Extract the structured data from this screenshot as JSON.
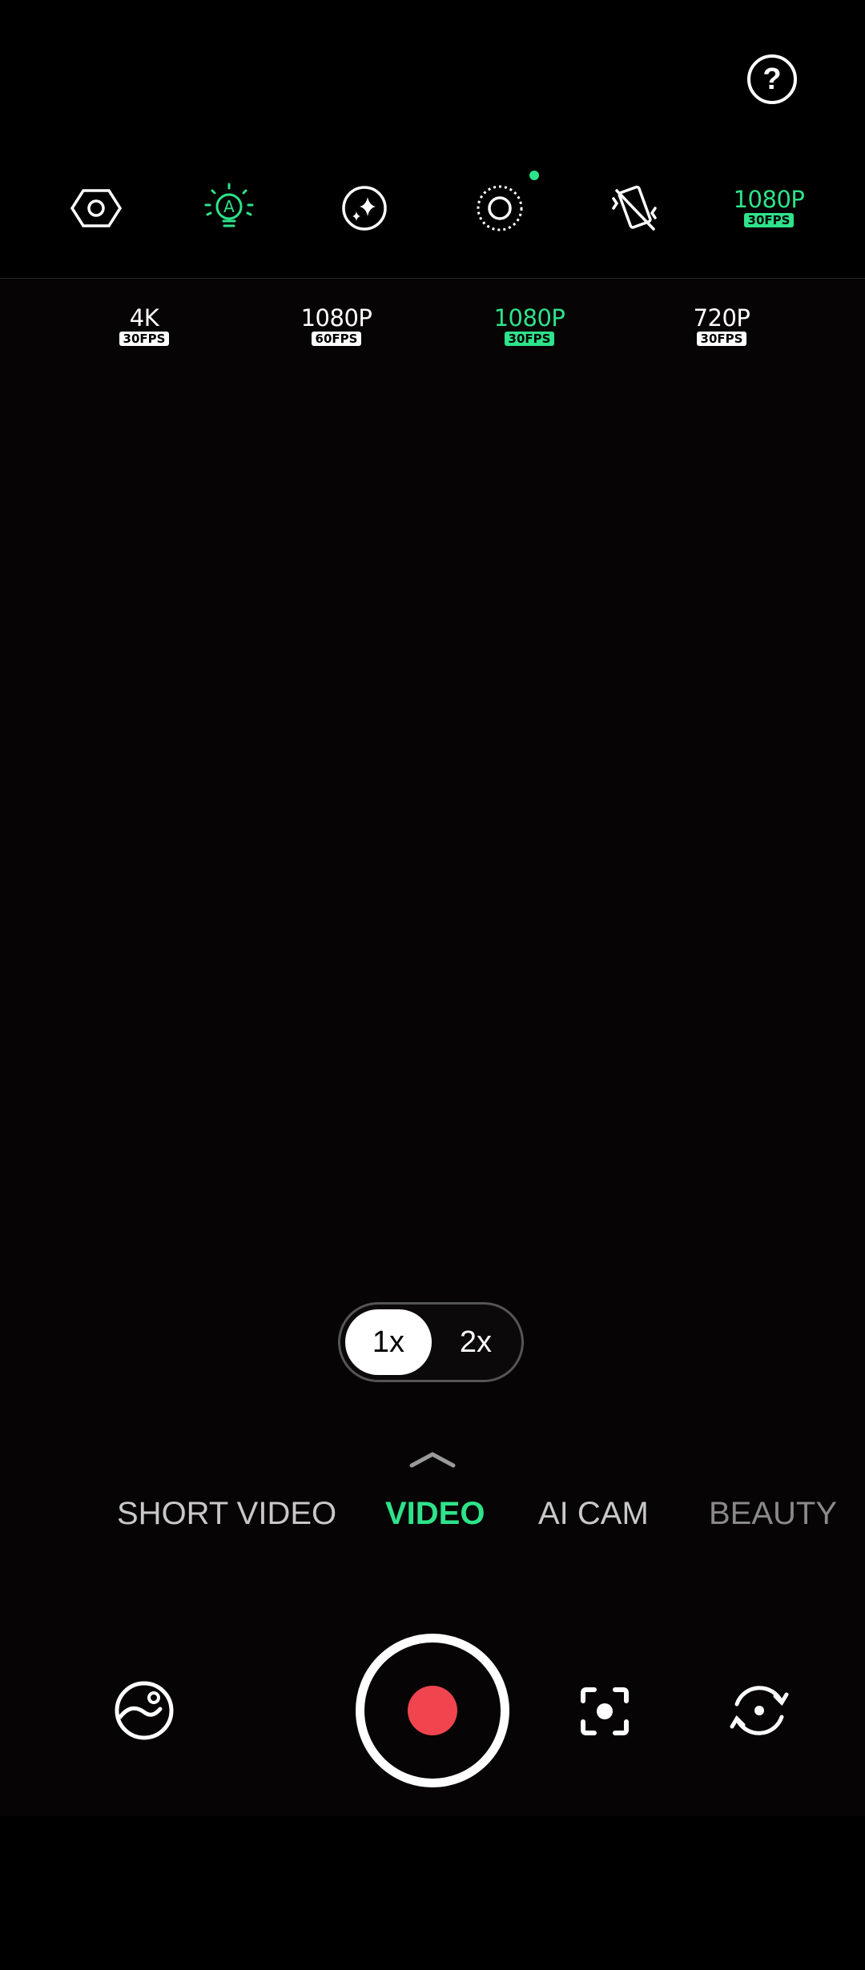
{
  "top_bar": {
    "help_label": "?"
  },
  "toolbar": {
    "icons": [
      {
        "name": "hexagon-settings-icon",
        "active": false
      },
      {
        "name": "auto-light-icon",
        "active": true,
        "label": "A"
      },
      {
        "name": "sparkle-filter-icon",
        "active": false
      },
      {
        "name": "dotted-circle-icon",
        "active": false,
        "has_dot": true
      },
      {
        "name": "stabilization-off-icon",
        "active": false
      }
    ],
    "current_resolution": {
      "main": "1080P",
      "sub": "30FPS"
    }
  },
  "resolution_options": [
    {
      "main": "4K",
      "sub": "30FPS",
      "selected": false
    },
    {
      "main": "1080P",
      "sub": "60FPS",
      "selected": false
    },
    {
      "main": "1080P",
      "sub": "30FPS",
      "selected": true
    },
    {
      "main": "720P",
      "sub": "30FPS",
      "selected": false
    }
  ],
  "zoom": {
    "options": [
      "1x",
      "2x"
    ],
    "selected": "1x"
  },
  "modes": {
    "items": [
      "SHORT VIDEO",
      "VIDEO",
      "AI CAM",
      "BEAUTY"
    ],
    "selected": "VIDEO"
  },
  "colors": {
    "accent": "#2ee38a",
    "record": "#f0454f",
    "background": "#000000"
  }
}
